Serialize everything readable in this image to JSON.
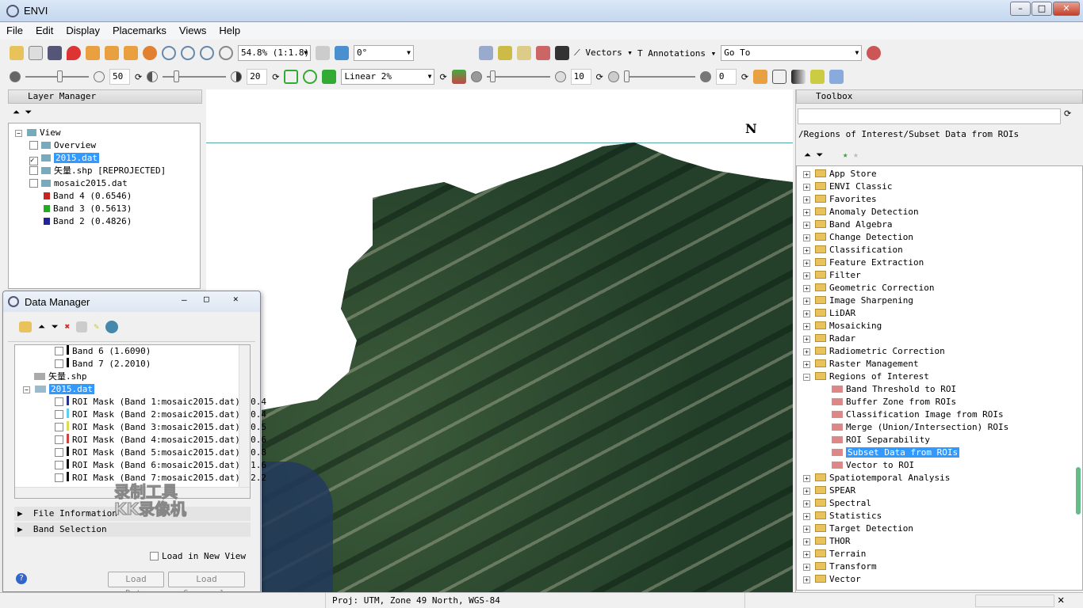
{
  "window": {
    "title": "ENVI",
    "min": "–",
    "max": "□",
    "close": "✕"
  },
  "menu": [
    "File",
    "Edit",
    "Display",
    "Placemarks",
    "Views",
    "Help"
  ],
  "toolbar": {
    "zoom": "54.8% (1:1.8)",
    "rotation": "0°",
    "vectors": "Vectors",
    "annotations": "Annotations",
    "goto": "Go To"
  },
  "toolbar2": {
    "brightness": "50",
    "contrast": "20",
    "stretch": "Linear 2%",
    "sharpen": "10",
    "transparency": "0"
  },
  "layer_manager": {
    "title": "Layer Manager",
    "items": [
      {
        "label": "View",
        "level": 0
      },
      {
        "label": "Overview",
        "level": 1
      },
      {
        "label": "2015.dat",
        "level": 1,
        "selected": true,
        "checked": true
      },
      {
        "label": "矢量.shp [REPROJECTED]",
        "level": 1
      },
      {
        "label": "mosaic2015.dat",
        "level": 1
      },
      {
        "label": "Band 4 (0.6546)",
        "level": 2,
        "color": "#cc2222"
      },
      {
        "label": "Band 3 (0.5613)",
        "level": 2,
        "color": "#22aa22"
      },
      {
        "label": "Band 2 (0.4826)",
        "level": 2,
        "color": "#222299"
      }
    ]
  },
  "data_manager": {
    "title": "Data Manager",
    "items": [
      {
        "label": "Band 6 (1.6090)",
        "level": 2,
        "color": "#000"
      },
      {
        "label": "Band 7 (2.2010)",
        "level": 2,
        "color": "#000"
      },
      {
        "label": "矢量.shp",
        "level": 1
      },
      {
        "label": "2015.dat",
        "level": 1,
        "selected": true
      },
      {
        "label": "ROI Mask (Band 1:mosaic2015.dat) (0.4",
        "level": 2,
        "color": "#223388"
      },
      {
        "label": "ROI Mask (Band 2:mosaic2015.dat) (0.4",
        "level": 2,
        "color": "#66ccee"
      },
      {
        "label": "ROI Mask (Band 3:mosaic2015.dat) (0.5",
        "level": 2,
        "color": "#dddd55"
      },
      {
        "label": "ROI Mask (Band 4:mosaic2015.dat) (0.6",
        "level": 2,
        "color": "#cc4444"
      },
      {
        "label": "ROI Mask (Band 5:mosaic2015.dat) (0.8",
        "level": 2,
        "color": "#111"
      },
      {
        "label": "ROI Mask (Band 6:mosaic2015.dat) (1.6",
        "level": 2,
        "color": "#111"
      },
      {
        "label": "ROI Mask (Band 7:mosaic2015.dat) (2.2",
        "level": 2,
        "color": "#111"
      }
    ],
    "file_information": "File Information",
    "band_selection": "Band Selection",
    "load_new_view": "Load in New View",
    "load_data": "Load Data",
    "load_grayscale": "Load Grayscale",
    "watermark": [
      "录制工具",
      "KK录像机"
    ]
  },
  "toolbox": {
    "title": "Toolbox",
    "search": "",
    "path": "/Regions of Interest/Subset Data from ROIs",
    "items": [
      {
        "label": "App Store",
        "type": "folder"
      },
      {
        "label": "ENVI Classic",
        "type": "folder"
      },
      {
        "label": "Favorites",
        "type": "folder"
      },
      {
        "label": "Anomaly Detection",
        "type": "folder"
      },
      {
        "label": "Band Algebra",
        "type": "folder"
      },
      {
        "label": "Change Detection",
        "type": "folder"
      },
      {
        "label": "Classification",
        "type": "folder"
      },
      {
        "label": "Feature Extraction",
        "type": "folder"
      },
      {
        "label": "Filter",
        "type": "folder"
      },
      {
        "label": "Geometric Correction",
        "type": "folder"
      },
      {
        "label": "Image Sharpening",
        "type": "folder"
      },
      {
        "label": "LiDAR",
        "type": "folder"
      },
      {
        "label": "Mosaicking",
        "type": "folder"
      },
      {
        "label": "Radar",
        "type": "folder"
      },
      {
        "label": "Radiometric Correction",
        "type": "folder"
      },
      {
        "label": "Raster Management",
        "type": "folder"
      },
      {
        "label": "Regions of Interest",
        "type": "open"
      },
      {
        "label": "Band Threshold to ROI",
        "type": "tool"
      },
      {
        "label": "Buffer Zone from ROIs",
        "type": "tool"
      },
      {
        "label": "Classification Image from ROIs",
        "type": "tool"
      },
      {
        "label": "Merge (Union/Intersection) ROIs",
        "type": "tool"
      },
      {
        "label": "ROI Separability",
        "type": "tool"
      },
      {
        "label": "Subset Data from ROIs",
        "type": "tool",
        "selected": true
      },
      {
        "label": "Vector to ROI",
        "type": "tool"
      },
      {
        "label": "Spatiotemporal Analysis",
        "type": "folder"
      },
      {
        "label": "SPEAR",
        "type": "folder"
      },
      {
        "label": "Spectral",
        "type": "folder"
      },
      {
        "label": "Statistics",
        "type": "folder"
      },
      {
        "label": "Target Detection",
        "type": "folder"
      },
      {
        "label": "THOR",
        "type": "folder"
      },
      {
        "label": "Terrain",
        "type": "folder"
      },
      {
        "label": "Transform",
        "type": "folder"
      },
      {
        "label": "Vector",
        "type": "folder"
      }
    ]
  },
  "map": {
    "north": "N"
  },
  "status": {
    "projection": "Proj: UTM, Zone 49 North, WGS-84"
  }
}
